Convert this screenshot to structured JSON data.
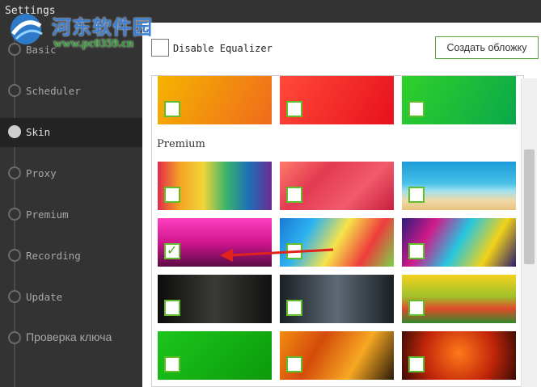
{
  "window": {
    "title": "Settings"
  },
  "sidebar": {
    "items": [
      {
        "label": "Basic",
        "active": false
      },
      {
        "label": "Scheduler",
        "active": false
      },
      {
        "label": "Skin",
        "active": true
      },
      {
        "label": "Proxy",
        "active": false
      },
      {
        "label": "Premium",
        "active": false
      },
      {
        "label": "Recording",
        "active": false
      },
      {
        "label": "Update",
        "active": false
      },
      {
        "label": "Проверка ключа",
        "active": false
      }
    ]
  },
  "watermark": {
    "site_name": "河东软件园",
    "url": "www.pc0359.cn"
  },
  "equalizer": {
    "label": "Disable Equalizer",
    "checked": false
  },
  "cover_button": {
    "label": "Создать обложку"
  },
  "skins": {
    "section_label": "Premium",
    "top_row": [
      {
        "name": "orange-gradient",
        "checked": false
      },
      {
        "name": "red-gradient",
        "checked": false
      },
      {
        "name": "green-gradient",
        "checked": false
      }
    ],
    "premium": [
      {
        "name": "colorful-hexagons",
        "checked": false
      },
      {
        "name": "red-polygons",
        "checked": false
      },
      {
        "name": "beach",
        "checked": false
      },
      {
        "name": "pink-bridge",
        "checked": true
      },
      {
        "name": "candy-rainbow",
        "checked": false
      },
      {
        "name": "abstract-swirls",
        "checked": false
      },
      {
        "name": "dark-forest",
        "checked": false
      },
      {
        "name": "dark-window",
        "checked": false
      },
      {
        "name": "sunburst-rainbow",
        "checked": false
      },
      {
        "name": "green-gradient-2",
        "checked": false
      },
      {
        "name": "halloween-orange",
        "checked": false
      },
      {
        "name": "halloween-pumpkins",
        "checked": false
      }
    ]
  },
  "colors": {
    "sidebar": "#333333",
    "accent": "#5fbf2a",
    "selected_bg": "#242424",
    "arrow": "#e0231c"
  },
  "icons": {
    "nav_dot": "circle-icon",
    "check": "checkmark-icon",
    "arrow": "arrow-left-icon"
  }
}
